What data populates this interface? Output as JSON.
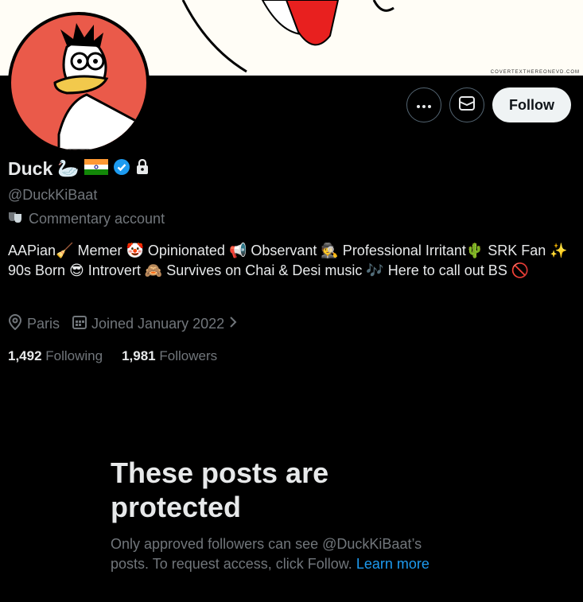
{
  "header": {
    "banner_credit": "COVERTEXTHEREONEVD.COM"
  },
  "actions": {
    "more_label": "More",
    "message_label": "Message",
    "follow_label": "Follow"
  },
  "profile": {
    "name": "Duck",
    "name_emoji": "🦢",
    "handle": "@DuckKiBaat",
    "account_label": "Commentary account",
    "bio": "AAPian🧹 Memer 🤡 Opinionated 📢 Observant 🕵️ Professional Irritant🌵 SRK Fan ✨ 90s Born 😎 Introvert 🙈 Survives on Chai & Desi music 🎶 Here to call out BS 🚫",
    "location": "Paris",
    "joined": "Joined January 2022",
    "following_count": "1,492",
    "following_label": "Following",
    "followers_count": "1,981",
    "followers_label": "Followers"
  },
  "protected": {
    "title": "These posts are protected",
    "text": "Only approved followers can see @DuckKiBaat’s posts. To request access, click Follow.",
    "link": "Learn more"
  },
  "colors": {
    "background": "#000000",
    "accent": "#1d9bf0",
    "muted": "#71767b",
    "avatar_bg": "#ea5a4a"
  },
  "icons": [
    "more-icon",
    "mail-icon",
    "verified-badge-icon",
    "lock-icon",
    "theater-masks-icon",
    "location-icon",
    "calendar-icon",
    "chevron-right-icon"
  ]
}
